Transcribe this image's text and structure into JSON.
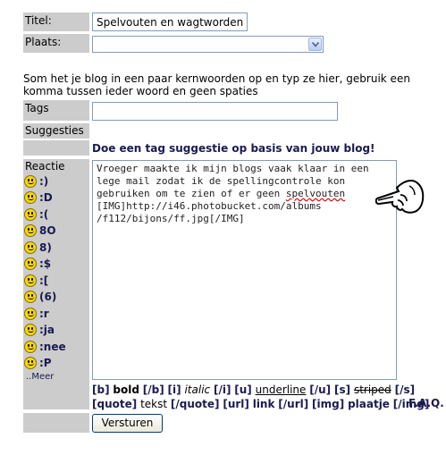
{
  "form": {
    "title_label": "Titel:",
    "title_value": "Spelvouten en wagtworden",
    "place_label": "Plaats:",
    "place_value": "",
    "help_text": "Som het je blog in een paar kernwoorden op en typ ze hier, gebruik een komma tussen ieder woord en geen spaties",
    "tags_label": "Tags",
    "tags_value": "",
    "suggestions_label": "Suggesties",
    "suggestion_link": "Doe een tag suggestie op basis van jouw blog!",
    "reaction_label": "Reactie",
    "reaction_text_1": "Vroeger maakte ik mijn blogs vaak klaar in een\nlege mail zodat ik de spellingcontrole kon\ngebruiken om te zien of er geen ",
    "reaction_text_misspelled": "spelvouten",
    "reaction_text_2": "\n[IMG]http://i46.photobucket.com/albums\n/f112/bijons/ff.jpg[/IMG]",
    "submit_label": "Versturen"
  },
  "smileys": [
    {
      "code": ":)",
      "icon": "smile-icon"
    },
    {
      "code": ":D",
      "icon": "grin-icon"
    },
    {
      "code": ":(",
      "icon": "sad-icon"
    },
    {
      "code": "8O",
      "icon": "surprised-icon"
    },
    {
      "code": "8)",
      "icon": "cool-icon"
    },
    {
      "code": ":$",
      "icon": "embarrassed-icon"
    },
    {
      "code": ":[",
      "icon": "worried-icon"
    },
    {
      "code": "(6)",
      "icon": "devil-icon"
    },
    {
      "code": ":r",
      "icon": "sick-icon"
    },
    {
      "code": ":ja",
      "icon": "yes-icon"
    },
    {
      "code": ":nee",
      "icon": "no-icon"
    },
    {
      "code": ":P",
      "icon": "tongue-icon"
    }
  ],
  "smiley_more": "..Meer",
  "bbcode": {
    "b_open": "[b]",
    "b_label": "bold",
    "b_close": "[/b]",
    "i_open": "[i]",
    "i_label": "italic",
    "i_close": "[/i]",
    "u_open": "[u]",
    "u_label": "underline",
    "u_close": "[/u]",
    "s_open": "[s]",
    "s_label": "striped",
    "s_close": "[/s]",
    "quote_open": "[quote]",
    "quote_label": "tekst",
    "quote_close": "[/quote]",
    "url_open": "[url]",
    "url_label": "link",
    "url_close": "[/url]",
    "img_open": "[img]",
    "img_label": "plaatje",
    "img_close": "[/img]"
  },
  "faq_label": "F.A.Q.",
  "colors": {
    "label_bg": "#cccccc",
    "link": "#1a1a52",
    "input_border": "#7f9db9"
  }
}
